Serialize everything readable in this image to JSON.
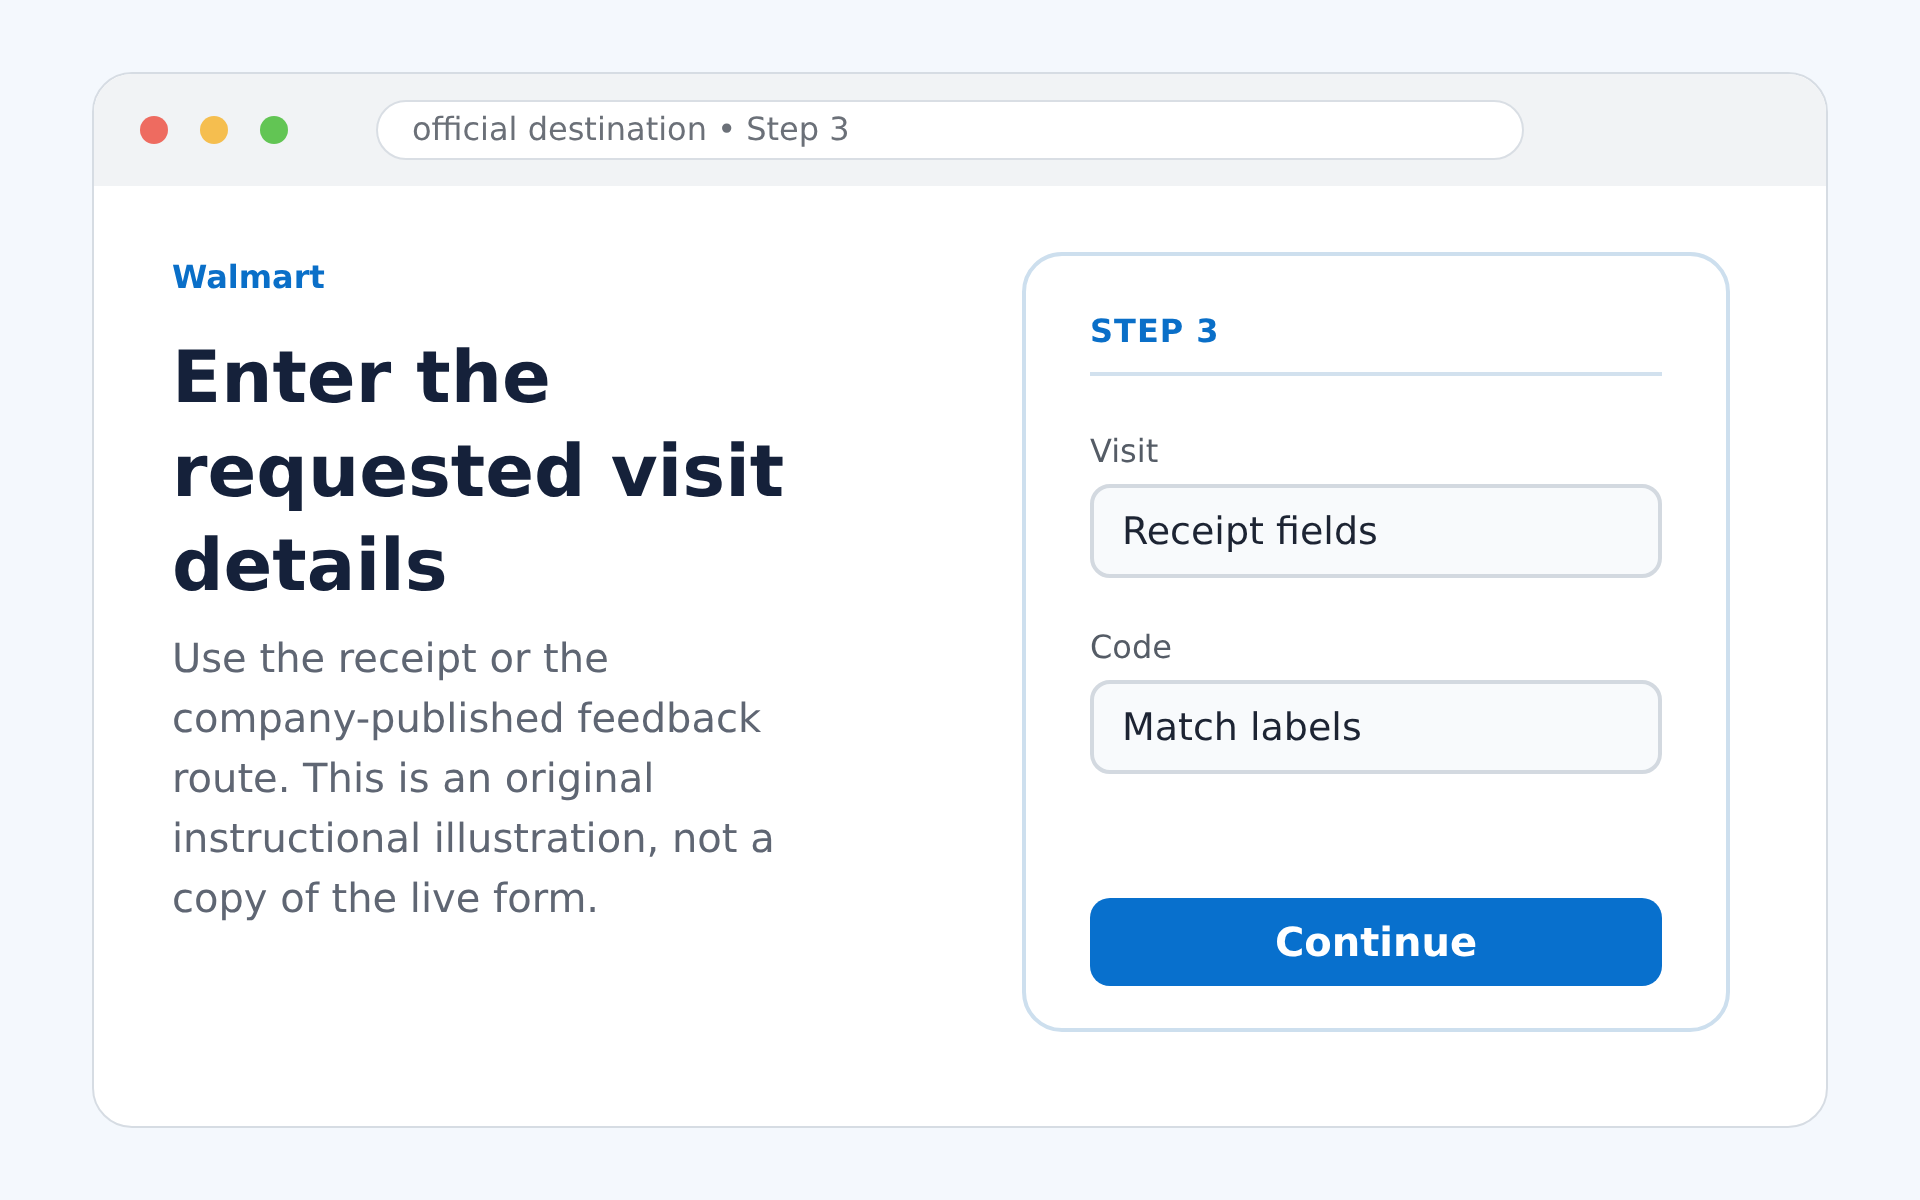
{
  "window": {
    "controls": [
      {
        "color": "#ee6b60"
      },
      {
        "color": "#f5be4f"
      },
      {
        "color": "#62c554"
      }
    ],
    "address_bar": {
      "text": "official destination • Step 3"
    }
  },
  "intro": {
    "brand": "Walmart",
    "heading": "Enter the requested visit details",
    "description": "Use the receipt or the company-published feedback route. This is an original instructional illustration, not a copy of the live form."
  },
  "form": {
    "step": "STEP 3",
    "fields": [
      {
        "label": "Visit",
        "value": "Receipt fields"
      },
      {
        "label": "Code",
        "value": "Match labels"
      }
    ],
    "button": "Continue"
  }
}
